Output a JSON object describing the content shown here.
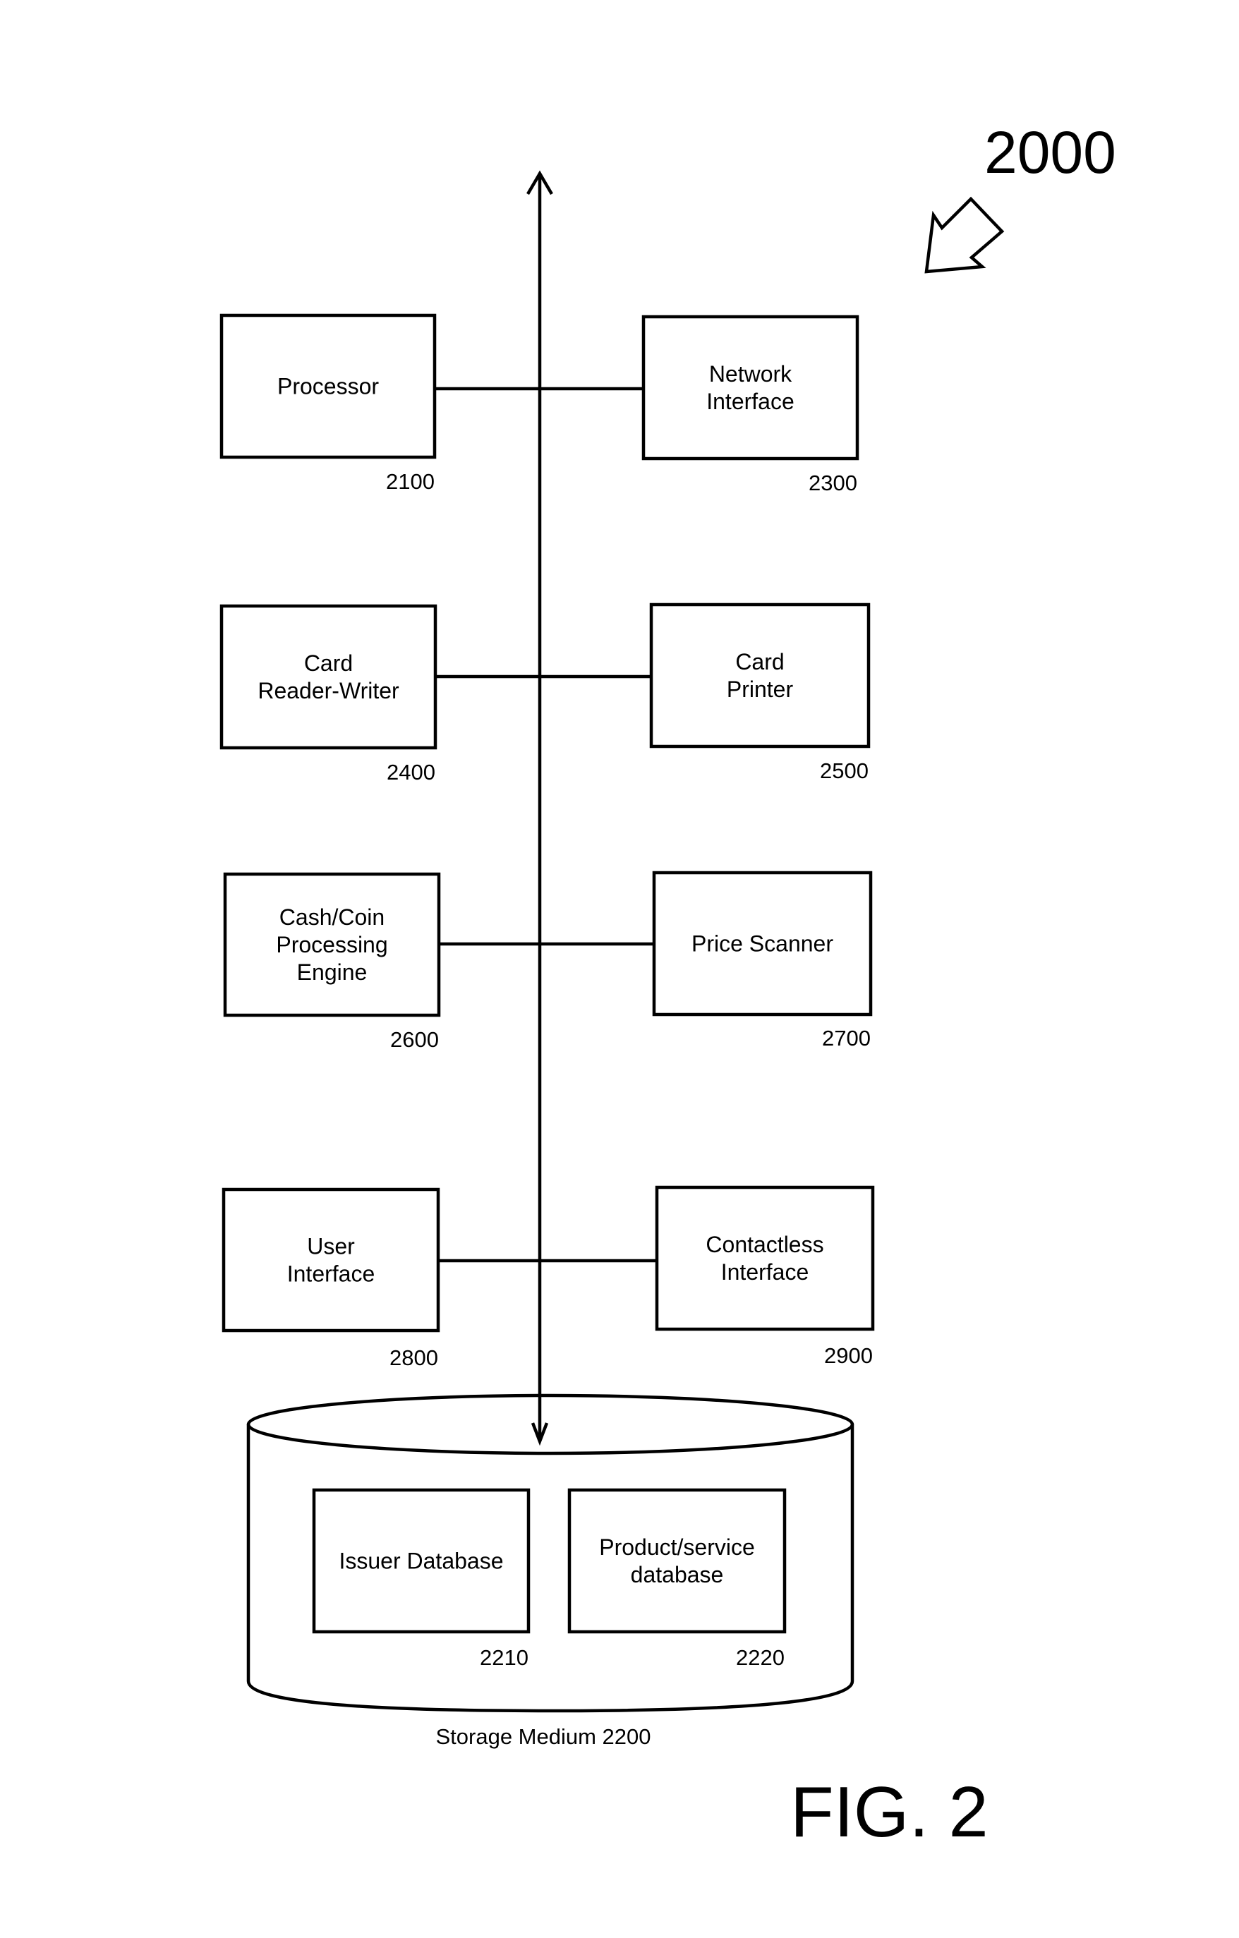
{
  "figure": {
    "reference_number": "2000",
    "caption": "FIG. 2"
  },
  "components": [
    {
      "id": "processor",
      "lines": [
        "Processor"
      ],
      "ref": "2100",
      "side": "left",
      "row": 0
    },
    {
      "id": "network-interface",
      "lines": [
        "Network",
        "Interface"
      ],
      "ref": "2300",
      "side": "right",
      "row": 0
    },
    {
      "id": "card-reader-writer",
      "lines": [
        "Card",
        "Reader-Writer"
      ],
      "ref": "2400",
      "side": "left",
      "row": 1
    },
    {
      "id": "card-printer",
      "lines": [
        "Card",
        "Printer"
      ],
      "ref": "2500",
      "side": "right",
      "row": 1
    },
    {
      "id": "cash-coin-engine",
      "lines": [
        "Cash/Coin",
        "Processing",
        "Engine"
      ],
      "ref": "2600",
      "side": "left",
      "row": 2
    },
    {
      "id": "price-scanner",
      "lines": [
        "Price Scanner"
      ],
      "ref": "2700",
      "side": "right",
      "row": 2
    },
    {
      "id": "user-interface",
      "lines": [
        "User",
        "Interface"
      ],
      "ref": "2800",
      "side": "left",
      "row": 3
    },
    {
      "id": "contactless-interface",
      "lines": [
        "Contactless",
        "Interface"
      ],
      "ref": "2900",
      "side": "right",
      "row": 3
    }
  ],
  "storage": {
    "label": "Storage Medium 2200",
    "databases": [
      {
        "id": "issuer-database",
        "lines": [
          "Issuer Database"
        ],
        "ref": "2210"
      },
      {
        "id": "product-service-database",
        "lines": [
          "Product/service",
          "database"
        ],
        "ref": "2220"
      }
    ]
  }
}
